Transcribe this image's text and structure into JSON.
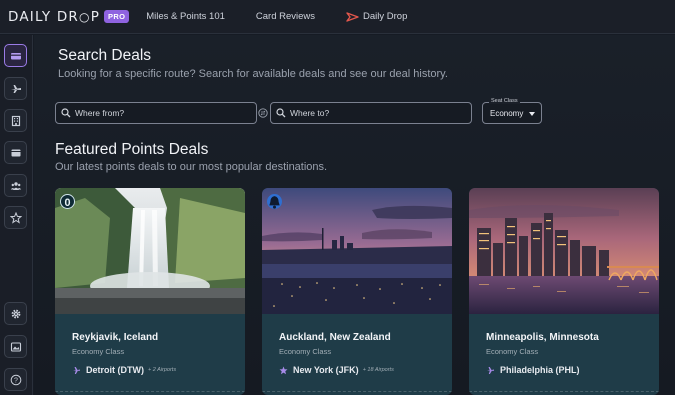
{
  "brand": {
    "name": "DAILY DR",
    "name_end": "P",
    "badge": "PRO",
    "accent": "#8f63e0"
  },
  "nav": {
    "items": [
      {
        "label": "Miles & Points 101"
      },
      {
        "label": "Card Reviews"
      },
      {
        "label": "Daily Drop",
        "icon": "daily-drop-logo-icon"
      }
    ]
  },
  "sidebar": {
    "items": [
      {
        "icon": "card-icon",
        "active": true
      },
      {
        "icon": "plane-icon"
      },
      {
        "icon": "hotel-icon"
      },
      {
        "icon": "wallet-icon"
      },
      {
        "icon": "people-icon"
      },
      {
        "icon": "star-icon"
      },
      {
        "icon": "settings-icon"
      },
      {
        "icon": "image-icon"
      },
      {
        "icon": "help-icon"
      }
    ]
  },
  "search": {
    "title": "Search Deals",
    "subtitle": "Looking for a specific route? Search for available deals and see our deal history.",
    "from_placeholder": "Where from?",
    "to_placeholder": "Where to?",
    "seat_class_label": "Seat Class",
    "seat_class_value": "Economy"
  },
  "featured": {
    "title": "Featured Points Deals",
    "subtitle": "Our latest points deals to our most popular destinations.",
    "cards": [
      {
        "city": "Reykjavik, Iceland",
        "class": "Economy Class",
        "airport": "Detroit (DTW)",
        "extra": "+ 2 Airports",
        "badge_icon": "zero-icon",
        "airport_icon": "plane-icon"
      },
      {
        "city": "Auckland, New Zealand",
        "class": "Economy Class",
        "airport": "New York (JFK)",
        "extra": "+ 18 Airports",
        "badge_icon": "bell-icon",
        "airport_icon": "star-icon"
      },
      {
        "city": "Minneapolis, Minnesota",
        "class": "Economy Class",
        "airport": "Philadelphia (PHL)",
        "extra": "",
        "badge_icon": "",
        "airport_icon": "plane-icon"
      }
    ]
  }
}
